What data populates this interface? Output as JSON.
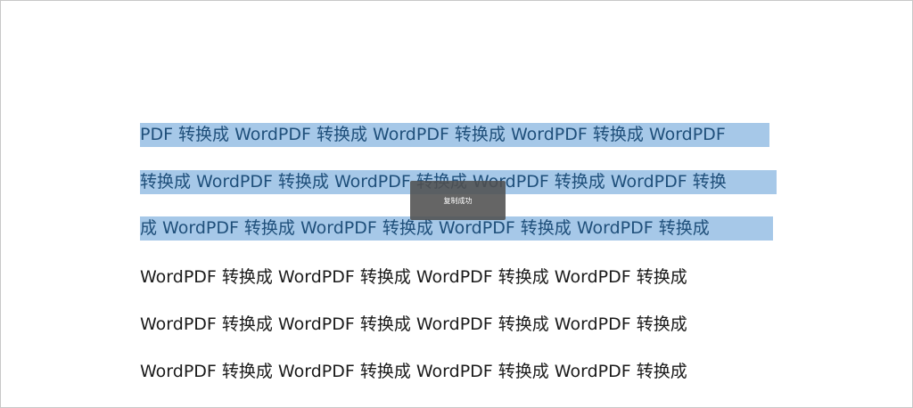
{
  "document": {
    "lines": [
      "PDF 转换成 WordPDF 转换成 WordPDF 转换成 WordPDF 转换成 WordPDF",
      "转换成 WordPDF 转换成 WordPDF 转换成 WordPDF 转换成 WordPDF 转换",
      "成 WordPDF 转换成 WordPDF 转换成 WordPDF 转换成 WordPDF 转换成",
      "WordPDF 转换成 WordPDF 转换成 WordPDF 转换成 WordPDF 转换成",
      "WordPDF 转换成 WordPDF 转换成 WordPDF 转换成 WordPDF 转换成",
      "WordPDF 转换成 WordPDF 转换成 WordPDF 转换成 WordPDF 转换成"
    ],
    "selected_line_count": 3,
    "selection_color": "#a6c8e8"
  },
  "toast": {
    "message": "复制成功"
  }
}
